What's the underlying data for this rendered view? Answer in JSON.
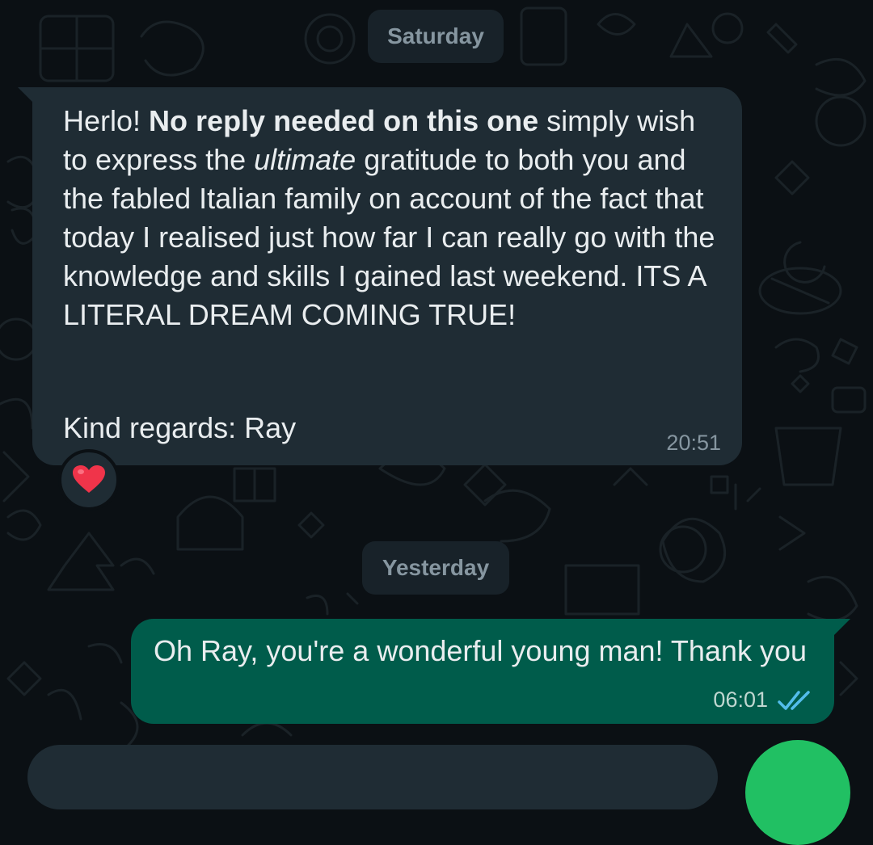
{
  "colors": {
    "background": "#0b1014",
    "incoming_bubble": "#1f2c34",
    "outgoing_bubble": "#005c4b",
    "date_chip": "#182229",
    "read_ticks": "#53bdeb",
    "fab": "#21c063"
  },
  "date_separators": {
    "first": "Saturday",
    "second": "Yesterday"
  },
  "incoming": {
    "greeting": "Herlo!",
    "bold_phrase": "No reply needed on this one",
    "text_before_italic": "simply wish to express the",
    "italic_word": "ultimate",
    "text_after_italic": "gratitude to both you and the fabled Italian family on account of the fact that today I realised just how far I can really go with the knowledge and skills I gained last weekend. ITS A LITERAL DREAM COMING TRUE!",
    "signoff": "Kind regards: Ray",
    "time": "20:51",
    "reaction": "red-heart"
  },
  "outgoing": {
    "text": "Oh Ray, you're a wonderful young man! Thank you",
    "time": "06:01",
    "status": "read-double-check"
  }
}
